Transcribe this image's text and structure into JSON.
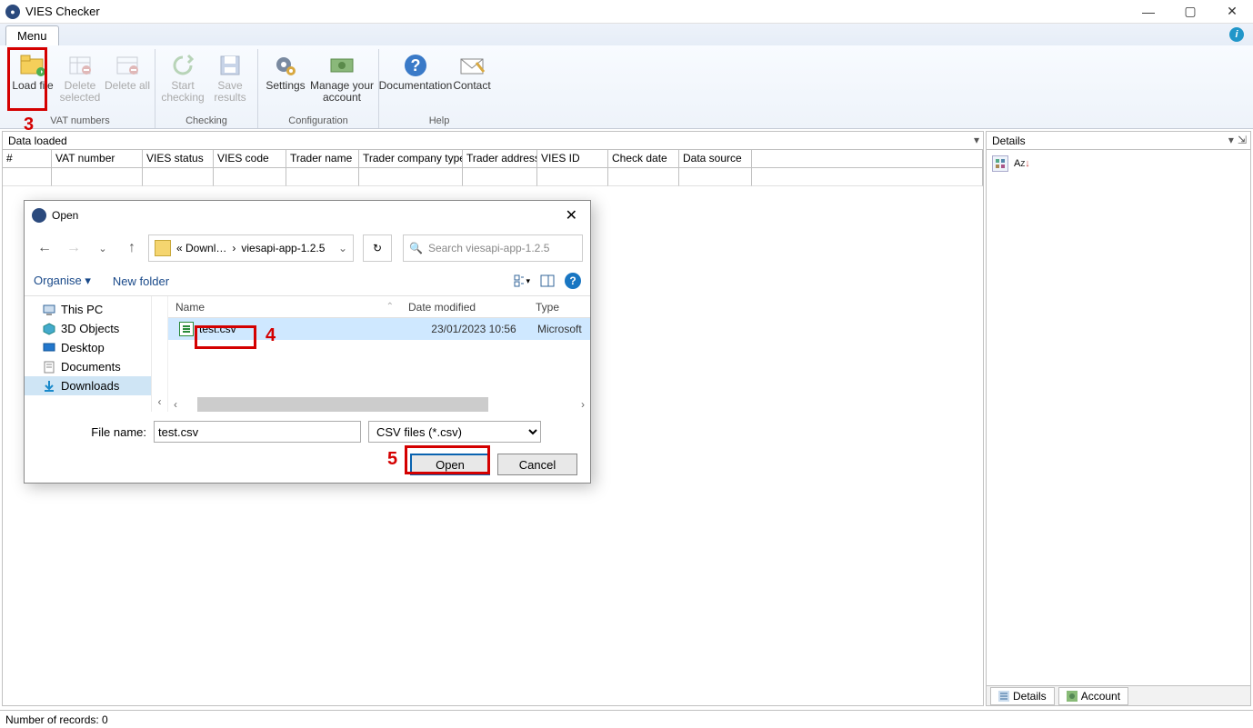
{
  "window": {
    "title": "VIES Checker"
  },
  "menu": {
    "tab": "Menu"
  },
  "ribbon": {
    "load_file": "Load file",
    "delete_selected": "Delete selected",
    "delete_all": "Delete all",
    "start_checking": "Start checking",
    "save_results": "Save results",
    "settings": "Settings",
    "manage_account": "Manage your account",
    "documentation": "Documentation",
    "contact": "Contact",
    "group_vat": "VAT numbers",
    "group_checking": "Checking",
    "group_config": "Configuration",
    "group_help": "Help"
  },
  "panels": {
    "data_loaded": "Data loaded",
    "details": "Details",
    "account_tab": "Account",
    "details_tab": "Details"
  },
  "grid": {
    "cols": [
      "#",
      "VAT number",
      "VIES status",
      "VIES code",
      "Trader name",
      "Trader company type",
      "Trader address",
      "VIES ID",
      "Check date",
      "Data source"
    ]
  },
  "status": {
    "records": "Number of records: 0"
  },
  "dialog": {
    "title": "Open",
    "breadcrumb_prefix": "«  Downl…",
    "breadcrumb_sep": "›",
    "breadcrumb_folder": "viesapi-app-1.2.5",
    "search_placeholder": "Search viesapi-app-1.2.5",
    "organise": "Organise ▾",
    "new_folder": "New folder",
    "nav": {
      "this_pc": "This PC",
      "objects3d": "3D Objects",
      "desktop": "Desktop",
      "documents": "Documents",
      "downloads": "Downloads"
    },
    "list_headers": {
      "name": "Name",
      "date": "Date modified",
      "type": "Type"
    },
    "file": {
      "name": "test.csv",
      "date": "23/01/2023 10:56",
      "type": "Microsoft"
    },
    "file_name_label": "File name:",
    "file_name_value": "test.csv",
    "filter": "CSV files (*.csv)",
    "open_btn": "Open",
    "cancel_btn": "Cancel"
  },
  "annotations": {
    "n3": "3",
    "n4": "4",
    "n5": "5"
  }
}
